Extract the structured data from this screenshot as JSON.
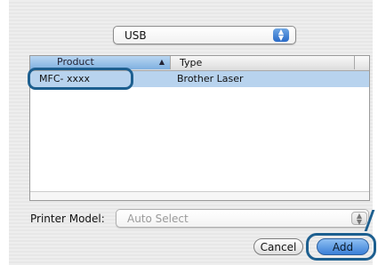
{
  "connection_popup": {
    "value": "USB"
  },
  "printer_list": {
    "columns": [
      "Product",
      "Type"
    ],
    "rows": [
      {
        "product": "MFC- xxxx",
        "type": "Brother Laser"
      }
    ]
  },
  "printer_model": {
    "label": "Printer Model:",
    "value": "Auto Select"
  },
  "buttons": {
    "cancel": "Cancel",
    "add": "Add"
  },
  "colors": {
    "selection": "#b8d3ee",
    "callout": "#1d5f8f",
    "default_button": "#3b7fd7"
  }
}
